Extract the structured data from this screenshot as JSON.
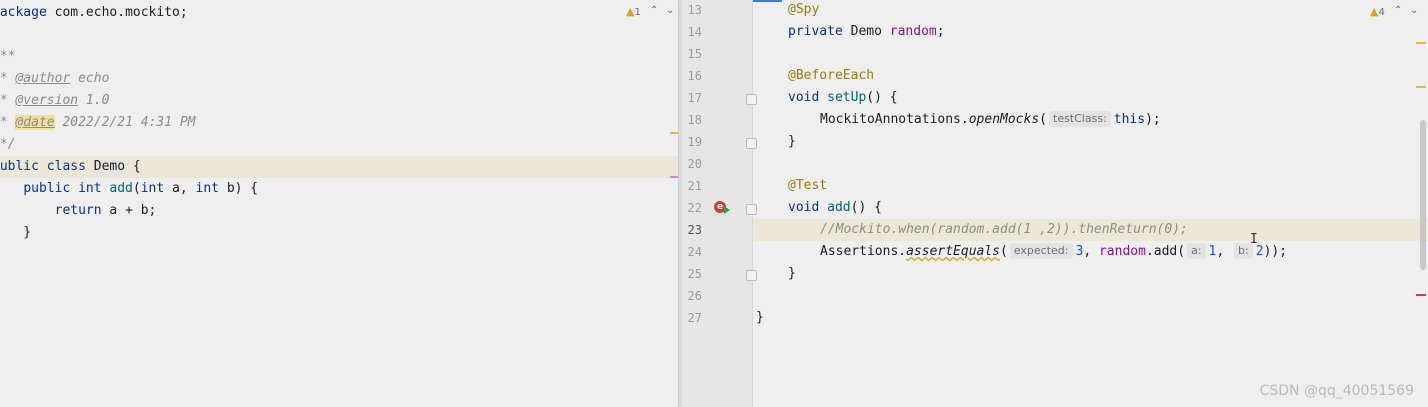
{
  "left_editor": {
    "warnings": {
      "count": "1"
    },
    "lines": {
      "package": {
        "kw": "package",
        "text": " com.echo.mockito;"
      },
      "doc_open": "/**",
      "author": {
        "prefix": " * ",
        "tag": "@author",
        "value": " echo"
      },
      "version": {
        "prefix": " * ",
        "tag": "@version",
        "value": " 1.0"
      },
      "date": {
        "prefix": " * ",
        "tag": "@date",
        "value": " 2022/2/21 4:31 PM"
      },
      "doc_close": " */",
      "class_decl": {
        "kw": "public class ",
        "name": "Demo",
        "rest": " {"
      },
      "method_decl": {
        "indent": "    ",
        "kw1": "public int ",
        "fn": "add",
        "p1": "(",
        "kw2": "int",
        "a": " a, ",
        "kw3": "int",
        "b": " b) {"
      },
      "return_stmt": {
        "indent": "        ",
        "kw": "return",
        "rest": " a + b;"
      },
      "method_close": "    }",
      "class_close": "}"
    }
  },
  "right_editor": {
    "warnings": {
      "count": "4"
    },
    "line_numbers": [
      "13",
      "14",
      "15",
      "16",
      "17",
      "18",
      "19",
      "20",
      "21",
      "22",
      "23",
      "24",
      "25",
      "26",
      "27"
    ],
    "lines": {
      "spy": "@Spy",
      "field": {
        "kw": "private",
        "type": " Demo ",
        "name": "random",
        "end": ";"
      },
      "before_each": "@BeforeEach",
      "setup_decl": {
        "kw": "void ",
        "fn": "setUp",
        "rest": "() {"
      },
      "open_mocks": {
        "cls": "MockitoAnnotations.",
        "fn": "openMocks",
        "p": "(",
        "hint": "testClass:",
        "kw": "this",
        "end": ");"
      },
      "setup_close": "}",
      "test_ann": "@Test",
      "add_decl": {
        "kw": "void ",
        "fn": "add",
        "rest": "() {"
      },
      "comment": "//Mockito.when(random.add(1 ,2)).thenReturn(0);",
      "assert": {
        "cls": "Assertions.",
        "fn": "assertEquals",
        "p": "(",
        "hint1": "expected:",
        "n1": "3",
        "mid": ", ",
        "field": "random",
        "call": ".add(",
        "hint2": "a:",
        "n2": "1",
        "sep": ", ",
        "hint3": "b:",
        "n3": "2",
        "end": "));"
      },
      "add_close": "}",
      "class_close": "}"
    }
  },
  "watermark": "CSDN @qq_40051569",
  "colors": {
    "keyword": "#0b2e8a",
    "annotation": "#9b7a10",
    "field": "#871094",
    "method": "#00627a",
    "comment": "#8c8c8c",
    "number": "#1750eb",
    "warning": "#d9a21b",
    "error": "#d63a3a"
  },
  "icons": {
    "warning": "warning-triangle-icon",
    "up": "chevron-up-icon",
    "down": "chevron-down-icon",
    "run": "run-test-icon"
  }
}
